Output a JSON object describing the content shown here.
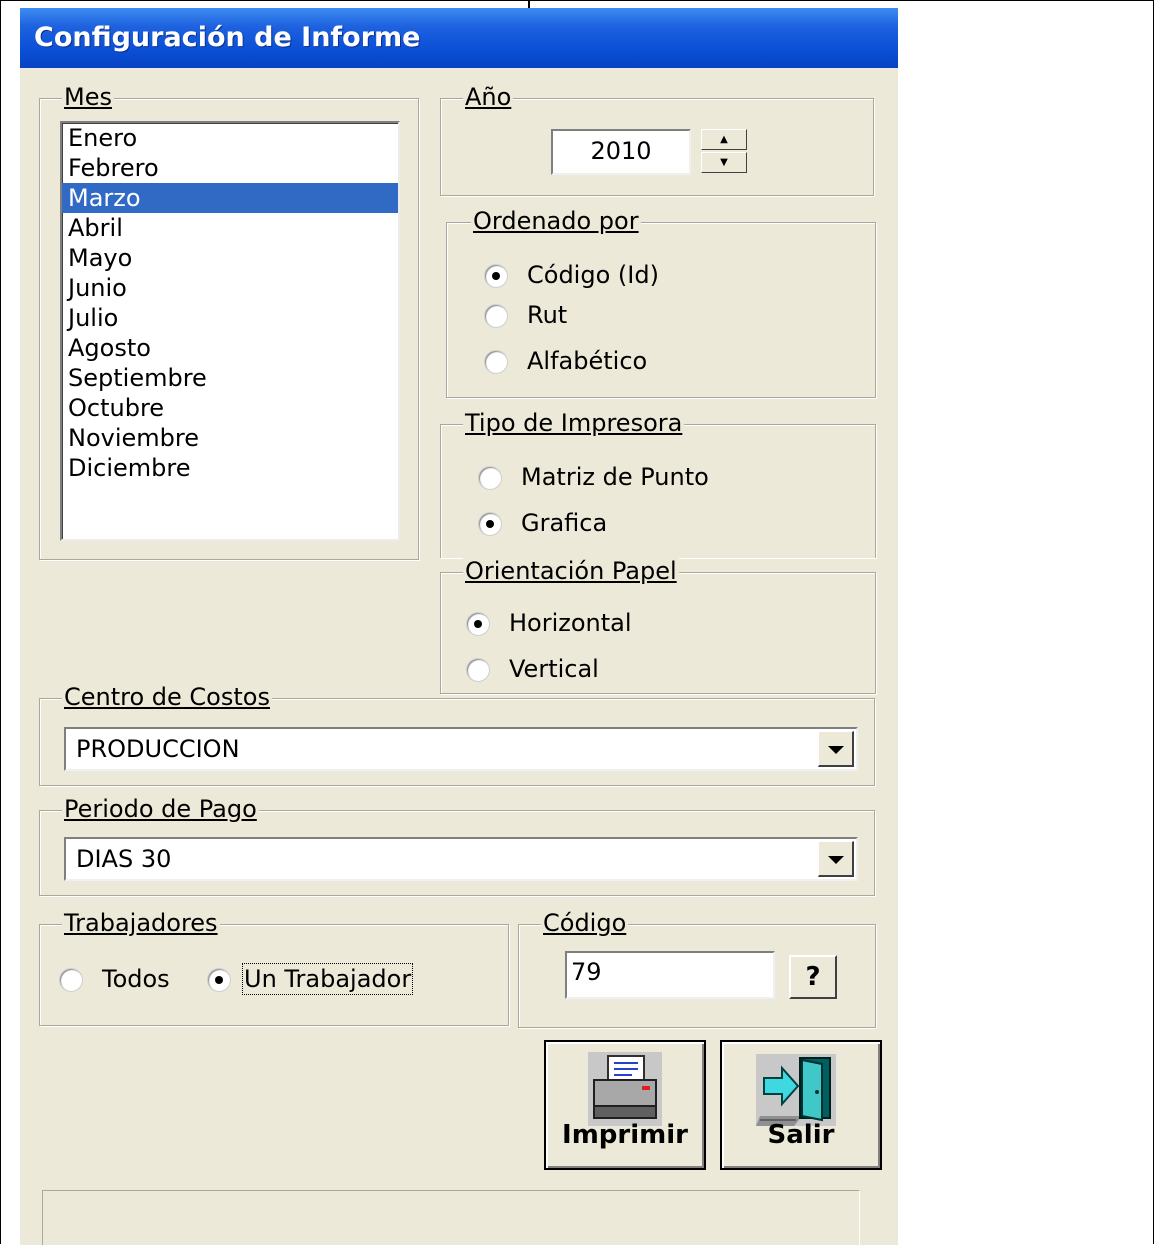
{
  "window": {
    "title": "Configuración de Informe"
  },
  "mes": {
    "legend": "Mes",
    "months": [
      "Enero",
      "Febrero",
      "Marzo",
      "Abril",
      "Mayo",
      "Junio",
      "Julio",
      "Agosto",
      "Septiembre",
      "Octubre",
      "Noviembre",
      "Diciembre"
    ],
    "selected": "Marzo"
  },
  "anio": {
    "legend": "Año",
    "value": "2010"
  },
  "ordenado": {
    "legend": "Ordenado por",
    "options": [
      "Código (Id)",
      "Rut",
      "Alfabético"
    ],
    "selected": "Código (Id)"
  },
  "impresora": {
    "legend": "Tipo de Impresora",
    "options": [
      "Matriz de Punto",
      "Grafica"
    ],
    "selected": "Grafica"
  },
  "orientacion": {
    "legend": "Orientación Papel",
    "options": [
      "Horizontal",
      "Vertical"
    ],
    "selected": "Horizontal"
  },
  "centro": {
    "legend": "Centro de Costos",
    "value": "PRODUCCION"
  },
  "periodo": {
    "legend": "Periodo de Pago",
    "value": "DIAS 30"
  },
  "trabajadores": {
    "legend": "Trabajadores",
    "options": [
      "Todos",
      "Un Trabajador"
    ],
    "selected": "Un Trabajador"
  },
  "codigo": {
    "legend": "Código",
    "value": "79",
    "lookup_label": "?"
  },
  "buttons": {
    "print": "Imprimir",
    "exit": "Salir"
  },
  "icons": {
    "print": "printer-icon",
    "exit": "exit-door-icon"
  }
}
